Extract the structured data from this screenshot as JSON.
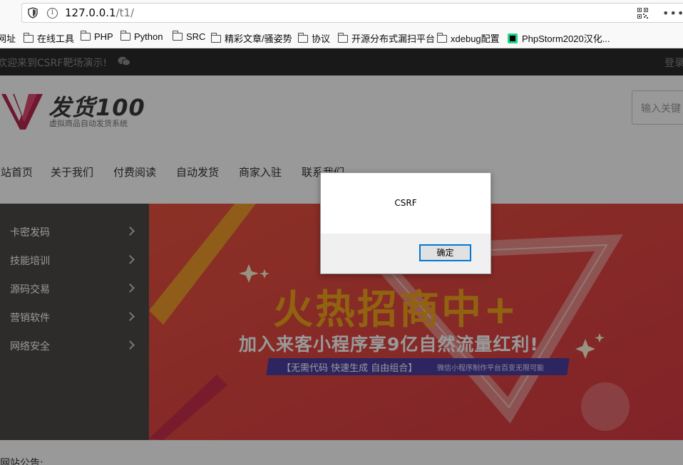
{
  "browser": {
    "url_host": "127.0.0.1",
    "url_path": "/t1/",
    "bookmarks": [
      {
        "label": "网址",
        "icon": "folder-icon"
      },
      {
        "label": "在线工具",
        "icon": "folder-icon"
      },
      {
        "label": "PHP",
        "icon": "folder-icon"
      },
      {
        "label": "Python",
        "icon": "folder-icon"
      },
      {
        "label": "SRC",
        "icon": "folder-icon"
      },
      {
        "label": "精彩文章/骚姿势",
        "icon": "folder-icon"
      },
      {
        "label": "协议",
        "icon": "folder-icon"
      },
      {
        "label": "开源分布式漏扫平台",
        "icon": "folder-icon"
      },
      {
        "label": "xdebug配置",
        "icon": "folder-icon"
      },
      {
        "label": "PhpStorm2020汉化...",
        "icon": "phpstorm-icon"
      }
    ]
  },
  "topbar": {
    "welcome": "欢迎来到CSRF靶场演示!",
    "login": "登录"
  },
  "header": {
    "logo_text": "发货100",
    "logo_sub": "虚拟商品自动发货系统",
    "search_placeholder": "输入关键"
  },
  "nav": [
    "网站首页",
    "关于我们",
    "付费阅读",
    "自动发货",
    "商家入驻",
    "联系我们"
  ],
  "sidebar": [
    {
      "label": "卡密发码"
    },
    {
      "label": "技能培训"
    },
    {
      "label": "源码交易"
    },
    {
      "label": "营销软件"
    },
    {
      "label": "网络安全"
    }
  ],
  "banner": {
    "headline": "火热招商中+",
    "subline": "加入来客小程序享9亿自然流量红利!",
    "ribbon_main": "【无需代码  快速生成  自由组合】",
    "ribbon_note": "微信小程序制作平台百变无限可能"
  },
  "notice": "网站公告:",
  "dialog": {
    "message": "CSRF",
    "ok_label": "确定"
  },
  "colors": {
    "topbar": "#2b2b2b",
    "sidebar": "#4e4848",
    "banner_red": "#e24a3b",
    "headline": "#f2a61c",
    "dialog_accent": "#0078d7"
  }
}
